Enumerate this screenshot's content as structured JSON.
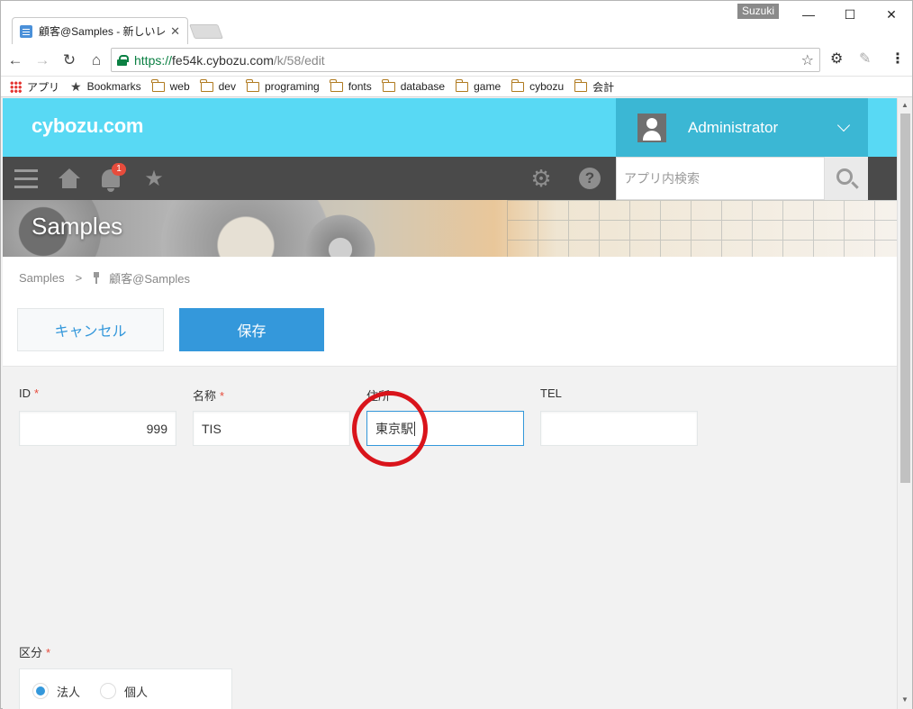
{
  "browser": {
    "tab_title": "顧客@Samples - 新しいレ",
    "profile_name": "Suzuki",
    "url_scheme": "https://",
    "url_host": "fe54k.cybozu.com",
    "url_path": "/k/58/edit",
    "bookmarks": [
      {
        "label": "アプリ",
        "icon": "apps-icon"
      },
      {
        "label": "Bookmarks",
        "icon": "star-icon"
      },
      {
        "label": "web",
        "icon": "folder-icon"
      },
      {
        "label": "dev",
        "icon": "folder-icon"
      },
      {
        "label": "programing",
        "icon": "folder-icon"
      },
      {
        "label": "fonts",
        "icon": "folder-icon"
      },
      {
        "label": "database",
        "icon": "folder-icon"
      },
      {
        "label": "game",
        "icon": "folder-icon"
      },
      {
        "label": "cybozu",
        "icon": "folder-icon"
      },
      {
        "label": "会計",
        "icon": "folder-icon"
      }
    ]
  },
  "header": {
    "logo": "cybozu.com",
    "user_name": "Administrator",
    "notification_count": "1",
    "search_placeholder": "アプリ内検索",
    "accent_color": "#58d9f4"
  },
  "banner": {
    "title": "Samples"
  },
  "breadcrumb": {
    "space": "Samples",
    "separator": ">",
    "app": "顧客@Samples"
  },
  "actions": {
    "cancel_label": "キャンセル",
    "save_label": "保存",
    "save_color": "#3498db"
  },
  "form": {
    "required_mark": "*",
    "id": {
      "label": "ID",
      "value": "999"
    },
    "name": {
      "label": "名称",
      "value": "TIS"
    },
    "address": {
      "label": "住所",
      "value": "東京駅"
    },
    "tel": {
      "label": "TEL",
      "value": ""
    },
    "category": {
      "label": "区分",
      "options": [
        "法人",
        "個人"
      ],
      "selected": "法人"
    }
  }
}
